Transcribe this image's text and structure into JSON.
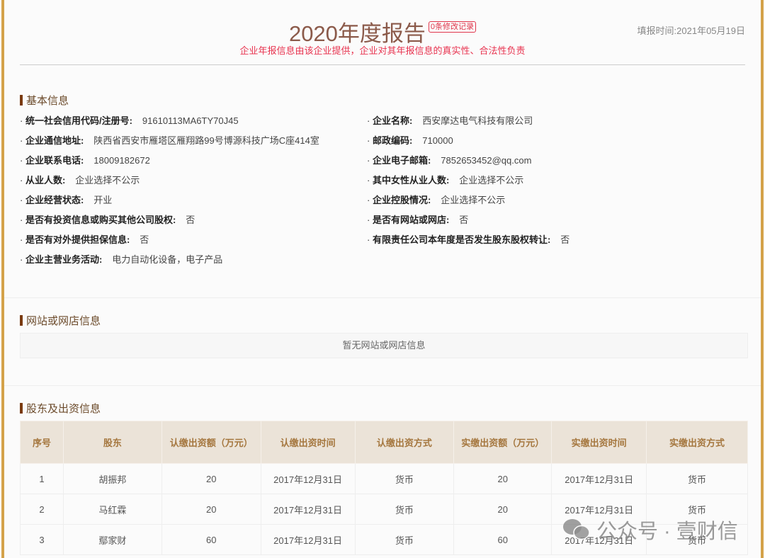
{
  "header": {
    "title": "2020年度报告",
    "badge": "0条修改记录",
    "subtitle": "企业年报信息由该企业提供，企业对其年报信息的真实性、合法性负责",
    "date": "填报时间:2021年05月19日"
  },
  "basic": {
    "title": "基本信息",
    "left": [
      {
        "label": "统一社会信用代码/注册号:",
        "value": "91610113MA6TY70J45"
      },
      {
        "label": "企业通信地址:",
        "value": "陕西省西安市雁塔区雁翔路99号博源科技广场C座414室"
      },
      {
        "label": "企业联系电话:",
        "value": "18009182672"
      },
      {
        "label": "从业人数:",
        "value": "企业选择不公示"
      },
      {
        "label": "企业经营状态:",
        "value": "开业"
      },
      {
        "label": "是否有投资信息或购买其他公司股权:",
        "value": "否"
      },
      {
        "label": "是否有对外提供担保信息:",
        "value": "否"
      },
      {
        "label": "企业主营业务活动:",
        "value": "电力自动化设备，电子产品"
      }
    ],
    "right": [
      {
        "label": "企业名称:",
        "value": "西安摩达电气科技有限公司"
      },
      {
        "label": "邮政编码:",
        "value": "710000"
      },
      {
        "label": "企业电子邮箱:",
        "value": "7852653452@qq.com"
      },
      {
        "label": "其中女性从业人数:",
        "value": "企业选择不公示"
      },
      {
        "label": "企业控股情况:",
        "value": "企业选择不公示"
      },
      {
        "label": "是否有网站或网店:",
        "value": "否"
      },
      {
        "label": "有限责任公司本年度是否发生股东股权转让:",
        "value": "否"
      }
    ]
  },
  "website": {
    "title": "网站或网店信息",
    "empty": "暂无网站或网店信息"
  },
  "shareholders": {
    "title": "股东及出资信息",
    "columns": [
      "序号",
      "股东",
      "认缴出资额（万元）",
      "认缴出资时间",
      "认缴出资方式",
      "实缴出资额（万元）",
      "实缴出资时间",
      "实缴出资方式"
    ],
    "rows": [
      [
        "1",
        "胡振邦",
        "20",
        "2017年12月31日",
        "货币",
        "20",
        "2017年12月31日",
        "货币"
      ],
      [
        "2",
        "马红霖",
        "20",
        "2017年12月31日",
        "货币",
        "20",
        "2017年12月31日",
        "货币"
      ],
      [
        "3",
        "鄢家财",
        "60",
        "2017年12月31日",
        "货币",
        "60",
        "2017年12月31日",
        "货币"
      ]
    ]
  },
  "watermark": "公众号 · 壹财信"
}
